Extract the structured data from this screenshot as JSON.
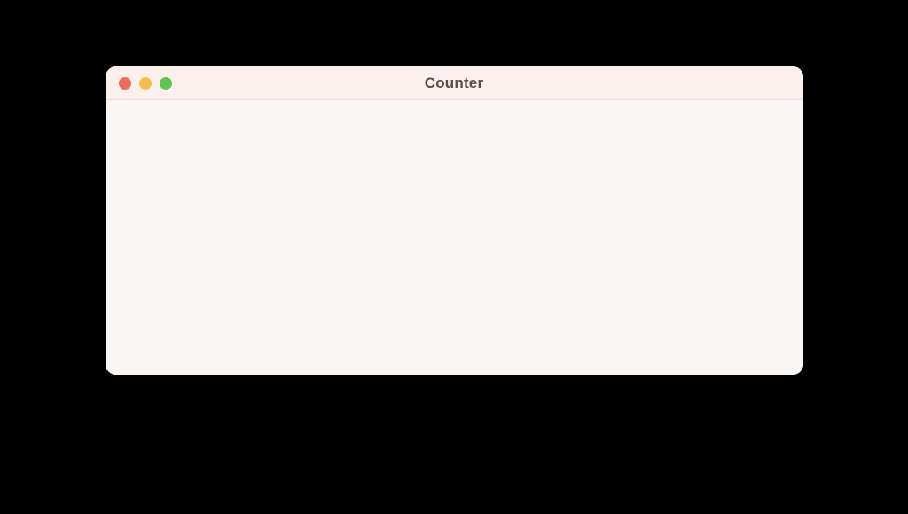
{
  "window": {
    "title": "Counter"
  }
}
